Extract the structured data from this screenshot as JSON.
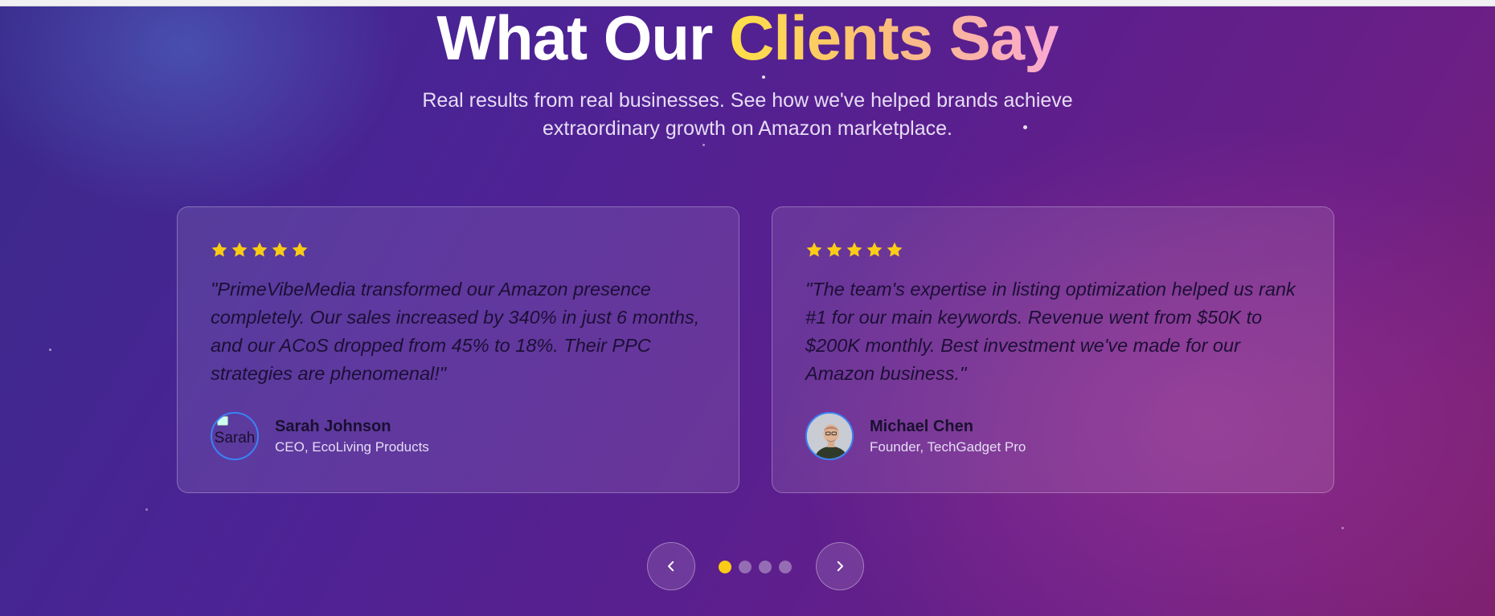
{
  "section": {
    "heading_part1": "What Our",
    "heading_part2": "Clients Say",
    "subtitle": "Real results from real businesses. See how we've helped brands achieve extraordinary growth on Amazon marketplace."
  },
  "testimonials": [
    {
      "rating": 5,
      "quote": "\"PrimeVibeMedia transformed our Amazon presence completely. Our sales increased by 340% in just 6 months, and our ACoS dropped from 45% to 18%. Their PPC strategies are phenomenal!\"",
      "name": "Sarah Johnson",
      "role": "CEO, EcoLiving Products",
      "avatar_alt": "Sarah"
    },
    {
      "rating": 5,
      "quote": "\"The team's expertise in listing optimization helped us rank #1 for our main keywords. Revenue went from $50K to $200K monthly. Best investment we've made for our Amazon business.\"",
      "name": "Michael Chen",
      "role": "Founder, TechGadget Pro"
    }
  ],
  "carousel": {
    "prev_icon": "chevron-left-icon",
    "next_icon": "chevron-right-icon",
    "total_dots": 4,
    "active_index": 0
  },
  "colors": {
    "star": "#facc15",
    "active_dot": "#facc15",
    "heading_gradient_start": "#fde047",
    "heading_gradient_end": "#f9a8d4"
  }
}
